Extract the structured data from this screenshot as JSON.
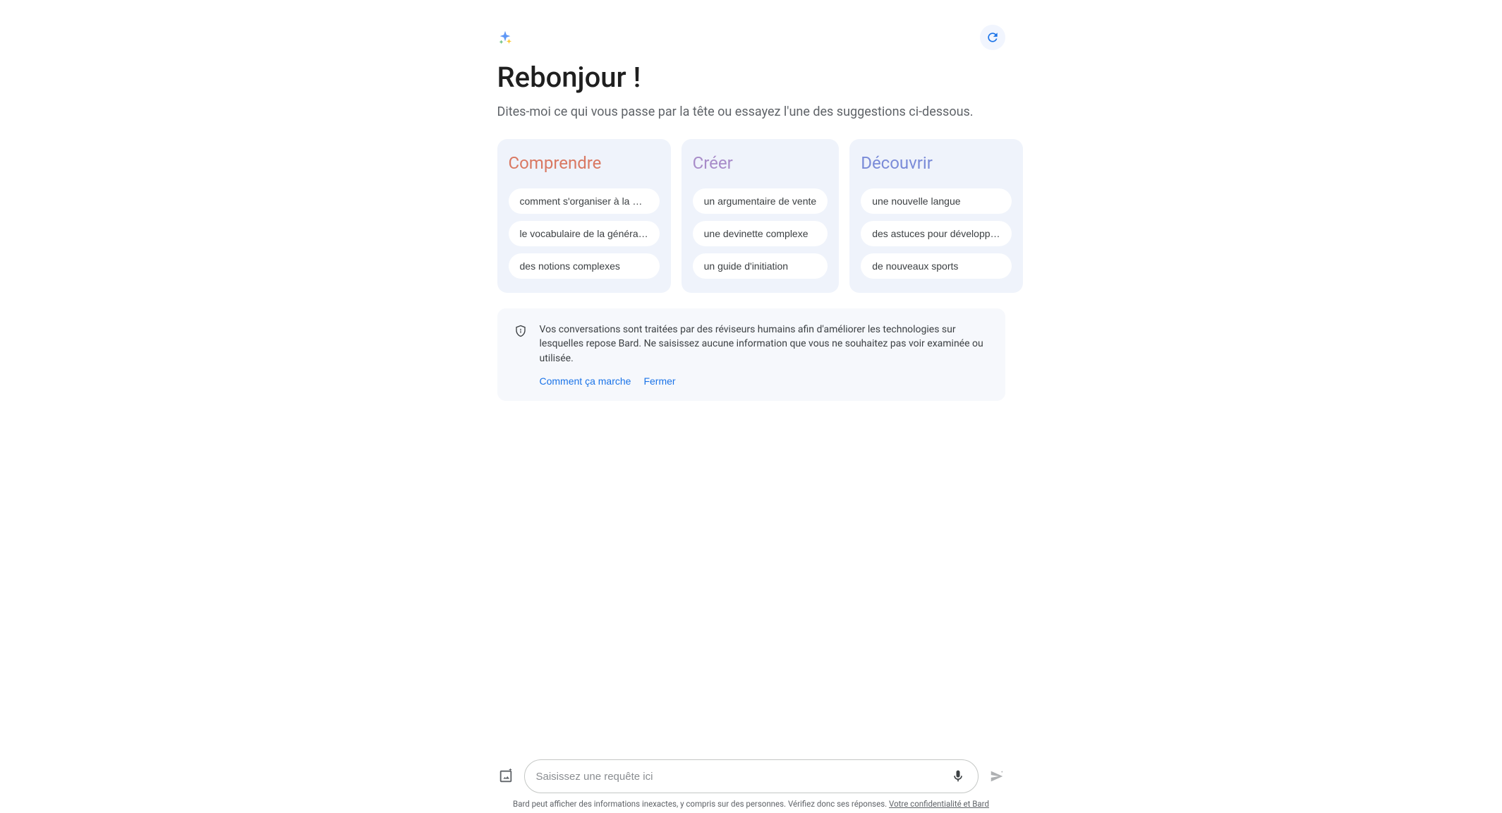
{
  "header": {
    "greeting": "Rebonjour !",
    "subtitle": "Dites-moi ce qui vous passe par la tête ou essayez l'une des suggestions ci-dessous."
  },
  "cards": {
    "comprendre": {
      "title": "Comprendre",
      "items": [
        "comment s'organiser à la …",
        "le vocabulaire de la généra…",
        "des notions complexes"
      ]
    },
    "creer": {
      "title": "Créer",
      "items": [
        "un argumentaire de vente",
        "une devinette complexe",
        "un guide d'initiation"
      ]
    },
    "decouvrir": {
      "title": "Découvrir",
      "items": [
        "une nouvelle langue",
        "des astuces pour développ…",
        "de nouveaux sports"
      ]
    }
  },
  "notice": {
    "text": "Vos conversations sont traitées par des réviseurs humains afin d'améliorer les technologies sur lesquelles repose Bard. Ne saisissez aucune information que vous ne souhaitez pas voir examinée ou utilisée.",
    "how_link": "Comment ça marche",
    "close_link": "Fermer"
  },
  "input": {
    "placeholder": "Saisissez une requête ici"
  },
  "disclaimer": {
    "text": "Bard peut afficher des informations inexactes, y compris sur des personnes. Vérifiez donc ses réponses. ",
    "link": "Votre confidentialité et Bard"
  }
}
